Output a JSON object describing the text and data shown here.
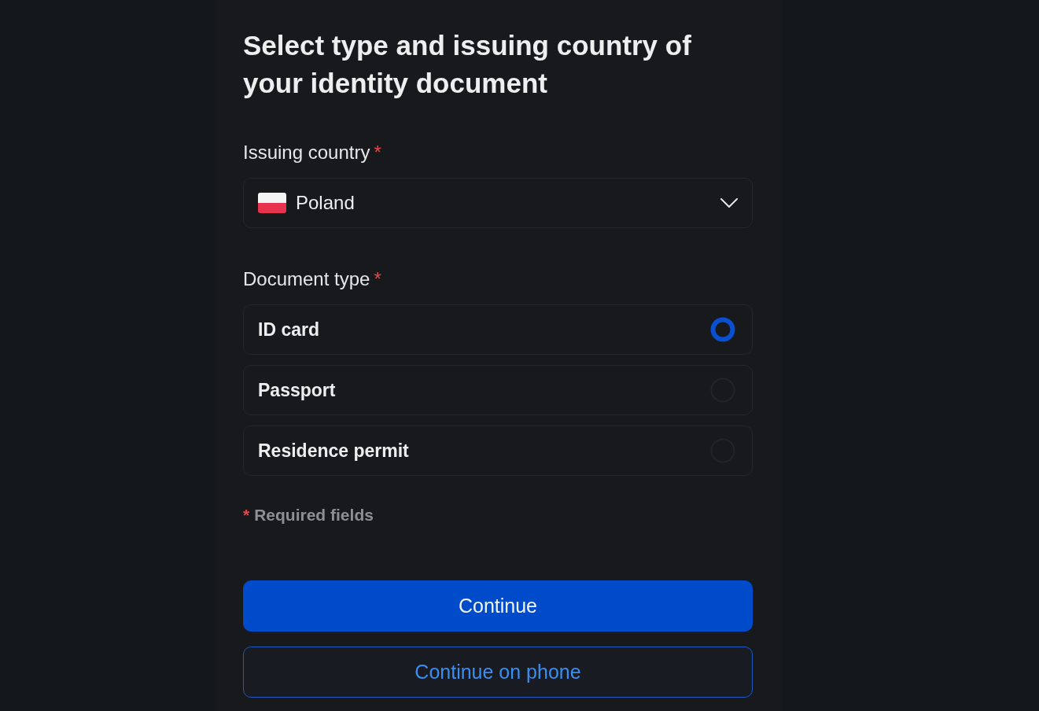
{
  "heading": "Select type and issuing country of your identity document",
  "country_field": {
    "label": "Issuing country",
    "required_mark": "*",
    "value": "Poland"
  },
  "document_type": {
    "label": "Document type",
    "required_mark": "*",
    "options": [
      {
        "label": "ID card",
        "selected": true
      },
      {
        "label": "Passport",
        "selected": false
      },
      {
        "label": "Residence permit",
        "selected": false
      }
    ]
  },
  "required_note": {
    "mark": "*",
    "text": "Required fields"
  },
  "buttons": [
    {
      "label": "Continue",
      "kind": "primary"
    },
    {
      "label": "Continue on phone",
      "kind": "outline"
    }
  ]
}
